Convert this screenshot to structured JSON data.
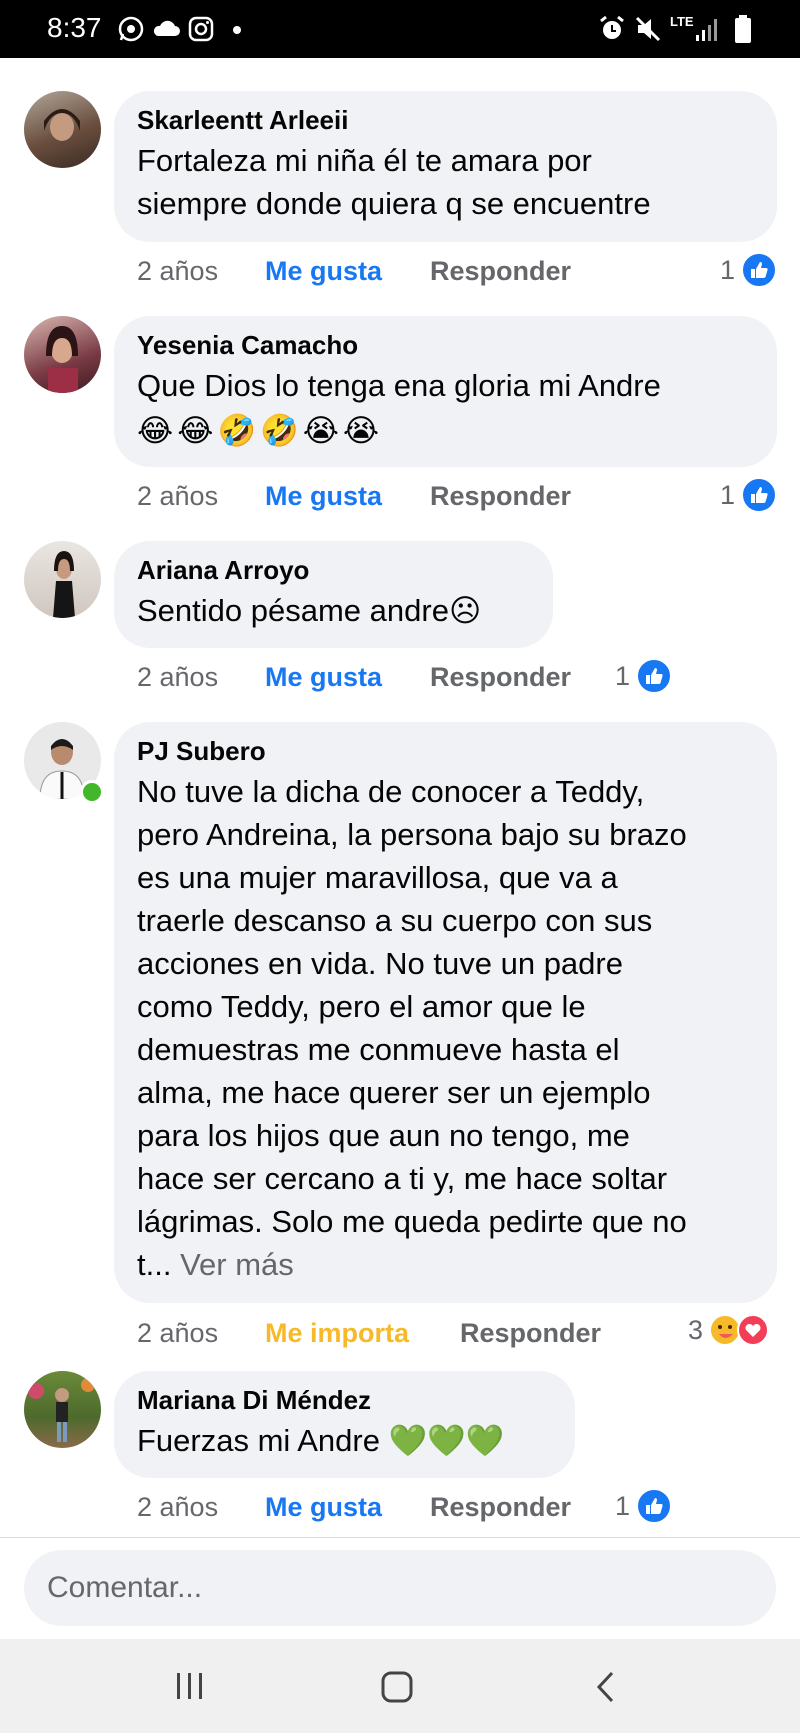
{
  "status_bar": {
    "time": "8:37",
    "network": "LTE"
  },
  "comments": [
    {
      "author": "Skarleentt Arleeii",
      "lines": [
        "Fortaleza mi niña él te amara por",
        "siempre donde quiera q se encuentre"
      ],
      "time": "2 años",
      "reaction_label": "Me gusta",
      "reply": "Responder",
      "count": "1"
    },
    {
      "author": "Yesenia Camacho",
      "lines": [
        "Que Dios lo tenga ena gloria mi Andre"
      ],
      "emoji_line": [
        "😂",
        "😂",
        "🤣",
        "🤣",
        "😭",
        "😭"
      ],
      "time": "2 años",
      "reaction_label": "Me gusta",
      "reply": "Responder",
      "count": "1"
    },
    {
      "author": "Ariana Arroyo",
      "lines": [
        "Sentido pésame andre☹"
      ],
      "time": "2 años",
      "reaction_label": "Me gusta",
      "reply": "Responder",
      "count": "1"
    },
    {
      "author": "PJ Subero",
      "lines": [
        "No tuve la dicha de conocer a Teddy,",
        "pero Andreina, la persona bajo su brazo",
        "es una mujer maravillosa, que va a",
        "traerle descanso a su cuerpo con sus",
        "acciones en vida. No tuve un padre",
        "como Teddy, pero el amor que le",
        "demuestras me conmueve hasta el",
        "alma, me hace querer ser un ejemplo",
        "para los hijos que aun no tengo, me",
        "hace ser cercano a ti y, me hace soltar",
        "lágrimas. Solo me queda pedirte que no",
        "t..."
      ],
      "more": "Ver más",
      "time": "2 años",
      "reaction_label": "Me importa",
      "reply": "Responder",
      "count": "3"
    },
    {
      "author": "Mariana Di Méndez",
      "lines": [
        "Fuerzas mi Andre 💚💚💚"
      ],
      "time": "2 años",
      "reaction_label": "Me gusta",
      "reply": "Responder",
      "count": "1"
    }
  ],
  "composer": {
    "placeholder": "Comentar..."
  },
  "colors": {
    "like_blue": "#1877f2",
    "care_yellow": "#f7b928",
    "bubble": "#f0f2f5",
    "online": "#42b72a"
  }
}
